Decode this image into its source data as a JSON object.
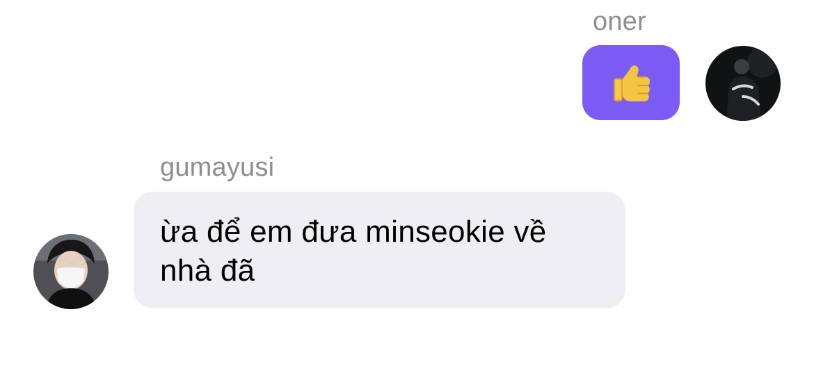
{
  "conversation": {
    "messages": [
      {
        "sender": "oner",
        "direction": "outgoing",
        "content_type": "emoji",
        "emoji_icon": "thumbs-up-icon",
        "bubble_color": "#7a5cf5"
      },
      {
        "sender": "gumayusi",
        "direction": "incoming",
        "content_type": "text",
        "text": "ừa để em đưa minseokie về\nnhà đã",
        "bubble_color": "#efeff3"
      }
    ]
  }
}
